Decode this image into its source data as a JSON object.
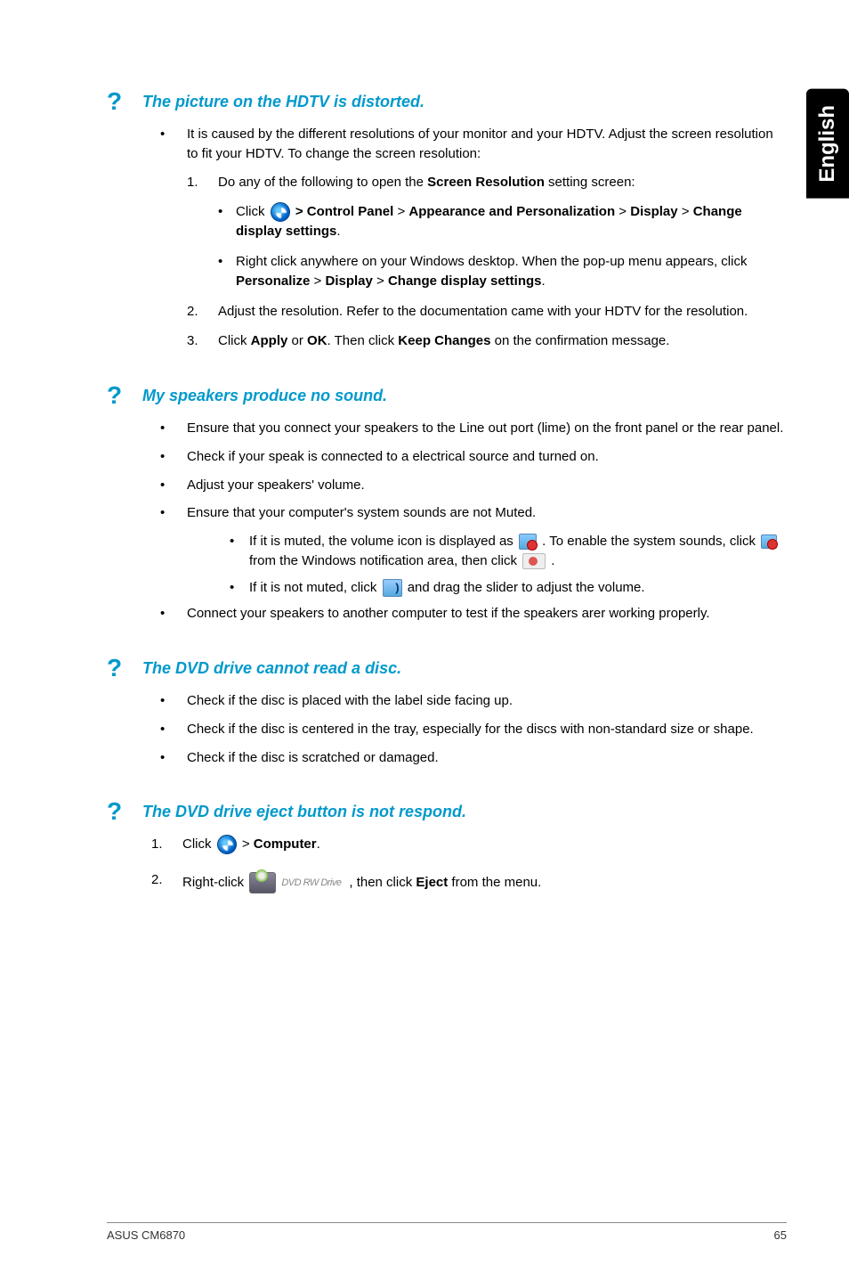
{
  "lang_tab": "English",
  "sections": [
    {
      "title": "The picture on the HDTV is distorted.",
      "intro": "It is caused by the different resolutions of your monitor and your HDTV. Adjust the screen resolution to fit your HDTV. To change the screen resolution:",
      "step1_lead": "Do any of the following to open the ",
      "step1_bold": "Screen Resolution",
      "step1_tail": " setting screen:",
      "sub1_pre": "Click ",
      "sub1_seq": " > Control Panel > Appearance and Personalization > Display > Change display settings",
      "sub2_pre": "Right click anywhere on your Windows desktop. When the pop-up menu appears, click ",
      "sub2_bold1": "Personalize",
      "sub2_mid1": " > ",
      "sub2_bold2": "Display",
      "sub2_mid2": " > ",
      "sub2_bold3": "Change display settings",
      "step2": "Adjust the resolution. Refer to the documentation came with your HDTV for the resolution.",
      "step3_pre": "Click ",
      "step3_b1": "Apply",
      "step3_mid1": " or ",
      "step3_b2": "OK",
      "step3_mid2": ". Then click ",
      "step3_b3": "Keep Changes",
      "step3_tail": " on the confirmation message."
    },
    {
      "title": "My speakers produce no sound.",
      "b1": "Ensure that you connect your speakers to the Line out port (lime) on the front panel or the rear panel.",
      "b2": "Check if your speak is connected to a electrical source and turned on.",
      "b3": "Adjust your speakers' volume.",
      "b4": "Ensure that your computer's system sounds are not Muted.",
      "b4a_pre": "If it is muted, the volume icon is displayed as ",
      "b4a_mid": " . To enable the system sounds, click ",
      "b4a_mid2": " from the Windows notification area, then click ",
      "b4b_pre": "If it is not muted, click ",
      "b4b_tail": " and drag the slider to adjust the volume.",
      "b5": "Connect your speakers to another computer to test if the speakers arer working properly."
    },
    {
      "title": "The DVD drive cannot read a disc.",
      "b1": "Check if the disc is placed with the label side facing up.",
      "b2": "Check if the disc is centered in the tray, especially for the discs with non-standard size or shape.",
      "b3": "Check if the disc is scratched or damaged."
    },
    {
      "title": "The DVD drive eject button is not respond.",
      "s1_pre": "Click ",
      "s1_mid": " > ",
      "s1_bold": "Computer",
      "s2_pre": "Right-click ",
      "s2_mid": ", then click ",
      "s2_bold": "Eject",
      "s2_tail": " from the menu.",
      "dvd_label": "DVD RW Drive"
    }
  ],
  "footer": {
    "left": "ASUS CM6870",
    "right": "65"
  }
}
